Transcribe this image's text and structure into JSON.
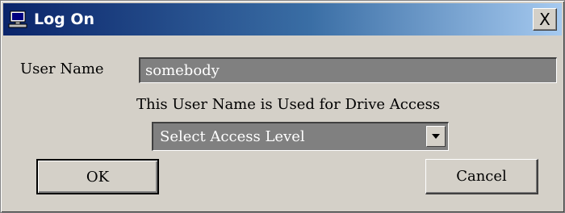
{
  "window": {
    "title": "Log On",
    "close_symbol": "X"
  },
  "form": {
    "user_name_label": "User Name",
    "user_name_value": "somebody",
    "info_text": "This User Name is Used for Drive Access",
    "access_level_selected": "Select Access Level"
  },
  "buttons": {
    "ok_label": "OK",
    "cancel_label": "Cancel"
  },
  "icons": {
    "title_icon": "computer-icon",
    "dropdown_icon": "triangle-down-icon"
  },
  "colors": {
    "titlebar_start": "#0a246a",
    "titlebar_end": "#a6caf0",
    "dialog_bg": "#d4d0c8",
    "field_bg": "#808080"
  }
}
